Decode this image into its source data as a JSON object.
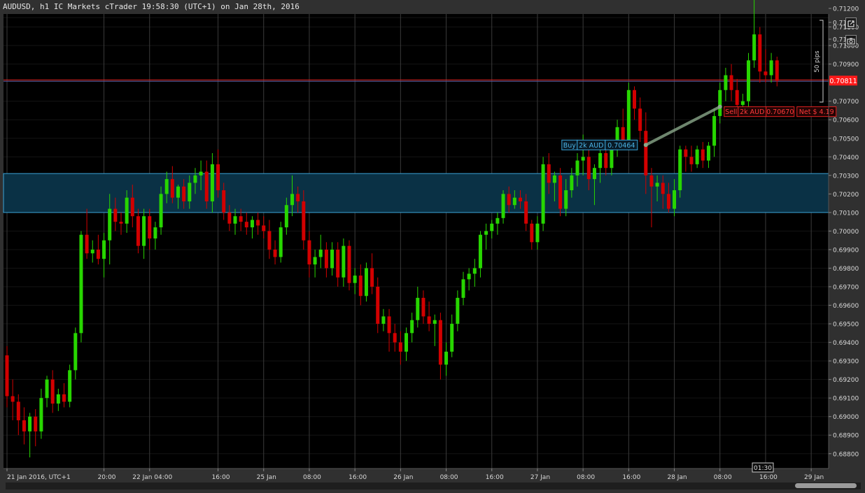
{
  "window": {
    "title": "AUDUSD, h1 IC Markets cTrader 19:58:30 (UTC+1) on Jan 28th, 2016"
  },
  "toolbar": {
    "popout_icon": "popout-icon",
    "camera_icon": "camera-icon"
  },
  "colors": {
    "background": "#000000",
    "bull": "#27d600",
    "bear": "#d20000",
    "zone_fill": "#0a3145",
    "zone_border": "#3aa3d6",
    "price_line": "#e02020",
    "price_tag": "#ff1a1a",
    "buy_box": "#3aa3d6",
    "sell_box": "#e02020",
    "trade_line": "#8aa88a",
    "grid": "#3a3a3a"
  },
  "chart_data": {
    "type": "candlestick",
    "symbol": "AUDUSD",
    "timeframe": "h1",
    "ylim": [
      0.6872,
      0.7117
    ],
    "y_ticks": [
      "0.71",
      "0.71",
      "0.71200",
      "0.71100",
      "0.71000",
      "0.70900",
      "0.70811",
      "0.70700",
      "0.70600",
      "0.70500",
      "0.70400",
      "0.70300",
      "0.70200",
      "0.70100",
      "0.70000",
      "0.69900",
      "0.69800",
      "0.69700",
      "0.69600",
      "0.69500",
      "0.69400",
      "0.69300",
      "0.69200",
      "0.69100",
      "0.69000",
      "0.68900",
      "0.68800"
    ],
    "y_tick_values": [
      0.7115,
      0.7125,
      0.712,
      0.711,
      0.71,
      0.709,
      0.70811,
      0.707,
      0.706,
      0.705,
      0.704,
      0.703,
      0.702,
      0.701,
      0.7,
      0.699,
      0.698,
      0.697,
      0.696,
      0.695,
      0.694,
      0.693,
      0.692,
      0.691,
      0.69,
      0.689,
      0.688
    ],
    "x_ticks": [
      "21 Jan 2016, UTC+1",
      "20:00",
      "22 Jan 04:00",
      "16:00",
      "25 Jan",
      "08:00",
      "16:00",
      "26 Jan",
      "08:00",
      "16:00",
      "27 Jan",
      "08:00",
      "16:00",
      "28 Jan",
      "08:00",
      "16:00",
      "29 Jan"
    ],
    "x_tick_bar_index": [
      0,
      17,
      25,
      37,
      45,
      53,
      61,
      69,
      77,
      85,
      93,
      101,
      109,
      117,
      125,
      133,
      141
    ],
    "current_price": "0.70811",
    "current_price_value": 0.70811,
    "time_marker": "01:30",
    "pip_ruler_label": "50 pips",
    "zone": {
      "low": 0.701,
      "high": 0.7031
    },
    "buy_label": {
      "side": "Buy",
      "size": "2k AUD",
      "price": "0.70464",
      "price_value": 0.70464,
      "bar_index": 112
    },
    "sell_label": {
      "side": "Sell",
      "size": "2k AUD",
      "price": "0.70670",
      "pnl": "Net $ 4.19",
      "price_value": 0.7067,
      "bar_index": 125
    },
    "candles": [
      [
        0.6933,
        0.6938,
        0.6905,
        0.6911
      ],
      [
        0.6911,
        0.692,
        0.6898,
        0.6908
      ],
      [
        0.6908,
        0.6912,
        0.689,
        0.6898
      ],
      [
        0.6898,
        0.6905,
        0.6885,
        0.6892
      ],
      [
        0.6892,
        0.6902,
        0.6878,
        0.69
      ],
      [
        0.69,
        0.6904,
        0.6884,
        0.6892
      ],
      [
        0.6892,
        0.6915,
        0.6888,
        0.691
      ],
      [
        0.691,
        0.6922,
        0.6905,
        0.692
      ],
      [
        0.692,
        0.6925,
        0.6902,
        0.6907
      ],
      [
        0.6907,
        0.6915,
        0.6903,
        0.6912
      ],
      [
        0.6912,
        0.6918,
        0.6905,
        0.6908
      ],
      [
        0.6908,
        0.6928,
        0.6905,
        0.6925
      ],
      [
        0.6925,
        0.6948,
        0.692,
        0.6945
      ],
      [
        0.6945,
        0.7,
        0.694,
        0.6998
      ],
      [
        0.6998,
        0.7012,
        0.6985,
        0.6988
      ],
      [
        0.6988,
        0.6995,
        0.6983,
        0.699
      ],
      [
        0.699,
        0.6998,
        0.6982,
        0.6985
      ],
      [
        0.6985,
        0.6999,
        0.6975,
        0.6995
      ],
      [
        0.6995,
        0.702,
        0.6982,
        0.7012
      ],
      [
        0.7012,
        0.7018,
        0.7,
        0.7005
      ],
      [
        0.7005,
        0.701,
        0.6998,
        0.7004
      ],
      [
        0.7004,
        0.7022,
        0.6999,
        0.7018
      ],
      [
        0.7018,
        0.7025,
        0.7002,
        0.7008
      ],
      [
        0.7008,
        0.7012,
        0.6988,
        0.6992
      ],
      [
        0.6992,
        0.7012,
        0.6985,
        0.7008
      ],
      [
        0.7008,
        0.7012,
        0.699,
        0.6996
      ],
      [
        0.6996,
        0.7005,
        0.699,
        0.7002
      ],
      [
        0.7002,
        0.7024,
        0.6998,
        0.702
      ],
      [
        0.702,
        0.7032,
        0.7015,
        0.7028
      ],
      [
        0.7028,
        0.7035,
        0.7015,
        0.7018
      ],
      [
        0.7018,
        0.7025,
        0.7012,
        0.7024
      ],
      [
        0.7024,
        0.7028,
        0.7012,
        0.7016
      ],
      [
        0.7016,
        0.703,
        0.7012,
        0.7026
      ],
      [
        0.7026,
        0.7034,
        0.702,
        0.703
      ],
      [
        0.703,
        0.7038,
        0.7022,
        0.7032
      ],
      [
        0.7032,
        0.7038,
        0.7012,
        0.7016
      ],
      [
        0.7016,
        0.7042,
        0.701,
        0.7036
      ],
      [
        0.7036,
        0.7044,
        0.7018,
        0.7022
      ],
      [
        0.7022,
        0.7026,
        0.7006,
        0.701
      ],
      [
        0.701,
        0.7014,
        0.7,
        0.7004
      ],
      [
        0.7004,
        0.7012,
        0.6998,
        0.7008
      ],
      [
        0.7008,
        0.7012,
        0.7,
        0.7005
      ],
      [
        0.7005,
        0.701,
        0.6998,
        0.7002
      ],
      [
        0.7002,
        0.7008,
        0.6996,
        0.7006
      ],
      [
        0.7006,
        0.701,
        0.6998,
        0.7003
      ],
      [
        0.7003,
        0.7008,
        0.6996,
        0.7
      ],
      [
        0.7,
        0.7006,
        0.6985,
        0.699
      ],
      [
        0.699,
        0.6995,
        0.6982,
        0.6986
      ],
      [
        0.6986,
        0.7005,
        0.6983,
        0.7002
      ],
      [
        0.7002,
        0.7018,
        0.6998,
        0.7014
      ],
      [
        0.7014,
        0.703,
        0.7008,
        0.702
      ],
      [
        0.702,
        0.7024,
        0.701,
        0.7016
      ],
      [
        0.7016,
        0.7022,
        0.699,
        0.6995
      ],
      [
        0.6995,
        0.7,
        0.6975,
        0.6982
      ],
      [
        0.6982,
        0.699,
        0.6975,
        0.6986
      ],
      [
        0.6986,
        0.6998,
        0.698,
        0.699
      ],
      [
        0.699,
        0.6994,
        0.6975,
        0.698
      ],
      [
        0.698,
        0.6994,
        0.6976,
        0.699
      ],
      [
        0.699,
        0.6994,
        0.697,
        0.6975
      ],
      [
        0.6975,
        0.6996,
        0.697,
        0.6992
      ],
      [
        0.6992,
        0.6995,
        0.6968,
        0.6972
      ],
      [
        0.6972,
        0.698,
        0.6966,
        0.6976
      ],
      [
        0.6976,
        0.6982,
        0.696,
        0.6965
      ],
      [
        0.6965,
        0.6983,
        0.6962,
        0.698
      ],
      [
        0.698,
        0.6988,
        0.6966,
        0.697
      ],
      [
        0.697,
        0.6975,
        0.6945,
        0.695
      ],
      [
        0.695,
        0.6958,
        0.6946,
        0.6954
      ],
      [
        0.6954,
        0.6958,
        0.6935,
        0.6945
      ],
      [
        0.6945,
        0.695,
        0.6935,
        0.694
      ],
      [
        0.694,
        0.6946,
        0.6928,
        0.6935
      ],
      [
        0.6935,
        0.6948,
        0.693,
        0.6945
      ],
      [
        0.6945,
        0.6956,
        0.694,
        0.6952
      ],
      [
        0.6952,
        0.697,
        0.6948,
        0.6964
      ],
      [
        0.6964,
        0.6968,
        0.695,
        0.6954
      ],
      [
        0.6954,
        0.6962,
        0.6946,
        0.695
      ],
      [
        0.695,
        0.6955,
        0.6938,
        0.6952
      ],
      [
        0.6952,
        0.6956,
        0.692,
        0.6928
      ],
      [
        0.6928,
        0.694,
        0.6922,
        0.6935
      ],
      [
        0.6935,
        0.6955,
        0.6932,
        0.695
      ],
      [
        0.695,
        0.6968,
        0.6946,
        0.6964
      ],
      [
        0.6964,
        0.6978,
        0.696,
        0.6974
      ],
      [
        0.6974,
        0.698,
        0.6968,
        0.6977
      ],
      [
        0.6977,
        0.6985,
        0.697,
        0.698
      ],
      [
        0.698,
        0.7,
        0.6975,
        0.6998
      ],
      [
        0.6998,
        0.7004,
        0.699,
        0.7
      ],
      [
        0.7,
        0.7006,
        0.6996,
        0.7004
      ],
      [
        0.7004,
        0.701,
        0.6998,
        0.7007
      ],
      [
        0.7007,
        0.7022,
        0.7004,
        0.702
      ],
      [
        0.702,
        0.7024,
        0.701,
        0.7014
      ],
      [
        0.7014,
        0.7022,
        0.7012,
        0.7018
      ],
      [
        0.7018,
        0.7022,
        0.7012,
        0.7016
      ],
      [
        0.7016,
        0.702,
        0.7,
        0.7004
      ],
      [
        0.7004,
        0.7006,
        0.699,
        0.6994
      ],
      [
        0.6994,
        0.7008,
        0.699,
        0.7004
      ],
      [
        0.7004,
        0.704,
        0.7,
        0.7036
      ],
      [
        0.7036,
        0.7042,
        0.702,
        0.7026
      ],
      [
        0.7026,
        0.7032,
        0.7016,
        0.703
      ],
      [
        0.703,
        0.7034,
        0.7008,
        0.7012
      ],
      [
        0.7012,
        0.7028,
        0.7008,
        0.7022
      ],
      [
        0.7022,
        0.7034,
        0.7018,
        0.703
      ],
      [
        0.703,
        0.7042,
        0.7024,
        0.7038
      ],
      [
        0.7038,
        0.7052,
        0.703,
        0.704
      ],
      [
        0.704,
        0.7048,
        0.7022,
        0.7028
      ],
      [
        0.7028,
        0.7036,
        0.7014,
        0.7034
      ],
      [
        0.7034,
        0.7044,
        0.7026,
        0.7042
      ],
      [
        0.7042,
        0.7046,
        0.703,
        0.7034
      ],
      [
        0.7034,
        0.7048,
        0.703,
        0.7044
      ],
      [
        0.7044,
        0.706,
        0.704,
        0.7056
      ],
      [
        0.7056,
        0.7066,
        0.7044,
        0.7048
      ],
      [
        0.7048,
        0.708,
        0.7044,
        0.7076
      ],
      [
        0.7076,
        0.7078,
        0.706,
        0.7066
      ],
      [
        0.7066,
        0.7072,
        0.7048,
        0.7054
      ],
      [
        0.7054,
        0.7064,
        0.702,
        0.703
      ],
      [
        0.703,
        0.7034,
        0.7002,
        0.7024
      ],
      [
        0.7024,
        0.703,
        0.7016,
        0.7026
      ],
      [
        0.7026,
        0.703,
        0.7012,
        0.702
      ],
      [
        0.702,
        0.7026,
        0.701,
        0.7012
      ],
      [
        0.7012,
        0.7028,
        0.7008,
        0.7022
      ],
      [
        0.7022,
        0.7046,
        0.7018,
        0.7044
      ],
      [
        0.7044,
        0.7046,
        0.7032,
        0.704
      ],
      [
        0.704,
        0.7046,
        0.7032,
        0.7036
      ],
      [
        0.7036,
        0.7046,
        0.7034,
        0.7044
      ],
      [
        0.7044,
        0.7048,
        0.7034,
        0.7038
      ],
      [
        0.7038,
        0.7048,
        0.7034,
        0.7046
      ],
      [
        0.7046,
        0.7066,
        0.704,
        0.7062
      ],
      [
        0.7062,
        0.708,
        0.7058,
        0.7076
      ],
      [
        0.7076,
        0.7088,
        0.707,
        0.7084
      ],
      [
        0.7084,
        0.709,
        0.707,
        0.7076
      ],
      [
        0.7076,
        0.7082,
        0.7062,
        0.7068
      ],
      [
        0.7068,
        0.7074,
        0.7062,
        0.707
      ],
      [
        0.707,
        0.7096,
        0.7066,
        0.7092
      ],
      [
        0.7092,
        0.7126,
        0.7088,
        0.7106
      ],
      [
        0.7106,
        0.711,
        0.708,
        0.7086
      ],
      [
        0.7086,
        0.7098,
        0.708,
        0.7084
      ],
      [
        0.7084,
        0.7096,
        0.708,
        0.7092
      ],
      [
        0.7092,
        0.7094,
        0.7078,
        0.7081
      ]
    ]
  }
}
